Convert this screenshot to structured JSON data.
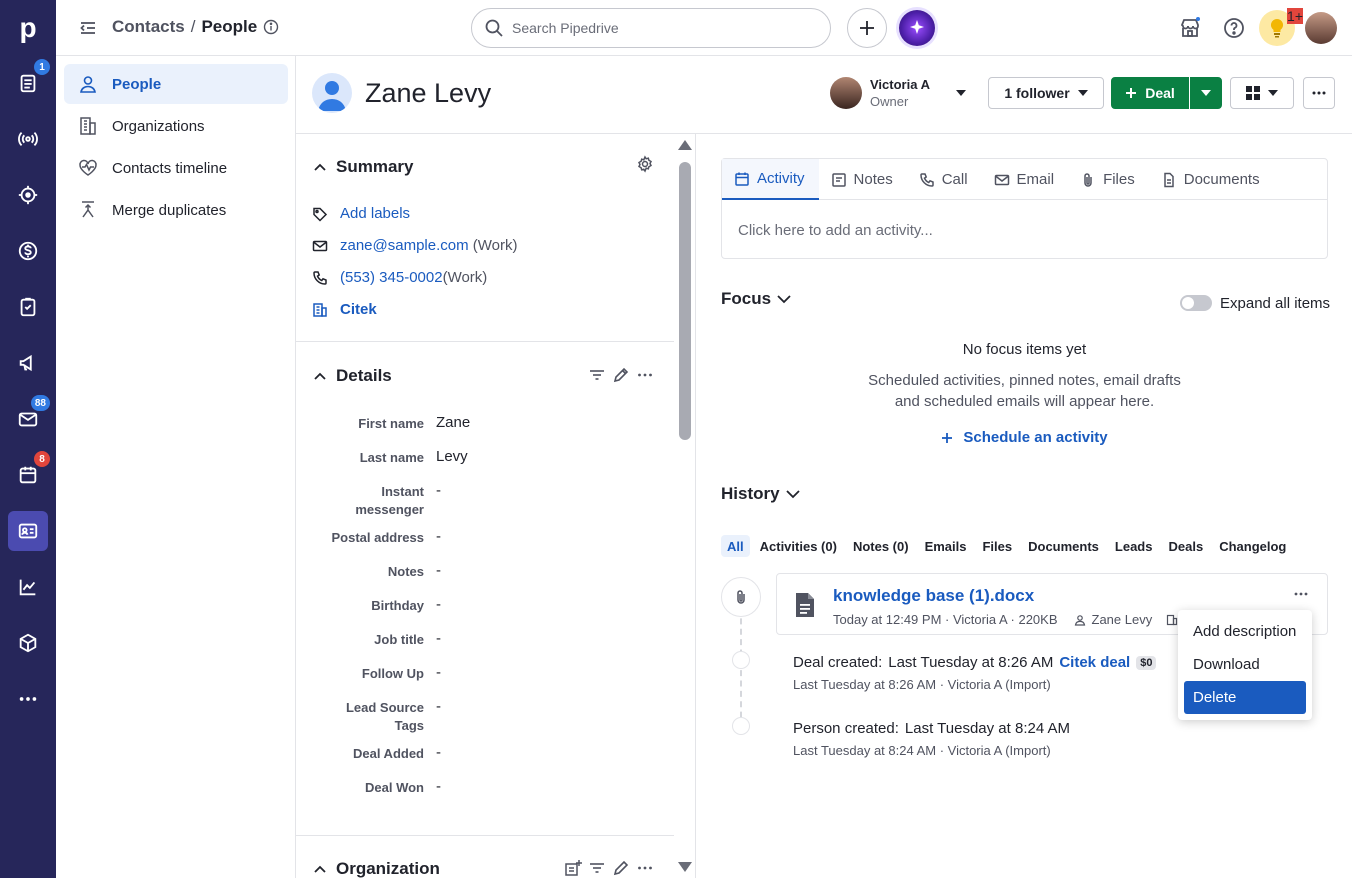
{
  "rail": {
    "logo": "p",
    "badges": {
      "deals": "1",
      "mail": "88",
      "calendar": "8"
    }
  },
  "topbar": {
    "crumb_parent": "Contacts",
    "crumb_sep": "/",
    "crumb_current": "People",
    "search_placeholder": "Search Pipedrive",
    "notif_badge": "1+"
  },
  "sidenav": {
    "items": [
      {
        "label": "People"
      },
      {
        "label": "Organizations"
      },
      {
        "label": "Contacts timeline"
      },
      {
        "label": "Merge duplicates"
      }
    ]
  },
  "person": {
    "name": "Zane Levy",
    "owner_name": "Victoria A",
    "owner_role": "Owner",
    "follower_label": "1 follower",
    "deal_label": "Deal"
  },
  "summary": {
    "title": "Summary",
    "add_labels": "Add labels",
    "email": "zane@sample.com",
    "email_type": "(Work)",
    "phone": "(553) 345-0002",
    "phone_type": "(Work)",
    "org": "Citek"
  },
  "details": {
    "title": "Details",
    "fields": [
      {
        "label": "First name",
        "value": "Zane"
      },
      {
        "label": "Last name",
        "value": "Levy"
      },
      {
        "label": "Instant messenger",
        "value": "-"
      },
      {
        "label": "Postal address",
        "value": "-"
      },
      {
        "label": "Notes",
        "value": "-"
      },
      {
        "label": "Birthday",
        "value": "-"
      },
      {
        "label": "Job title",
        "value": "-"
      },
      {
        "label": "Follow Up",
        "value": "-"
      },
      {
        "label": "Lead Source Tags",
        "value": "-"
      },
      {
        "label": "Deal Added",
        "value": "-"
      },
      {
        "label": "Deal Won",
        "value": "-"
      }
    ]
  },
  "organization": {
    "title": "Organization"
  },
  "composer": {
    "tabs": [
      {
        "label": "Activity"
      },
      {
        "label": "Notes"
      },
      {
        "label": "Call"
      },
      {
        "label": "Email"
      },
      {
        "label": "Files"
      },
      {
        "label": "Documents"
      }
    ],
    "placeholder": "Click here to add an activity..."
  },
  "focus": {
    "title": "Focus",
    "expand_label": "Expand all items",
    "empty_title": "No focus items yet",
    "empty_line1": "Scheduled activities, pinned notes, email drafts",
    "empty_line2": "and scheduled emails will appear here.",
    "schedule_label": "Schedule an activity"
  },
  "history": {
    "title": "History",
    "tabs": [
      "All",
      "Activities (0)",
      "Notes (0)",
      "Emails",
      "Files",
      "Documents",
      "Leads",
      "Deals",
      "Changelog"
    ],
    "file": {
      "name": "knowledge base (1).docx",
      "meta": "Today at 12:49 PM · Victoria A · 220KB",
      "person": "Zane Levy"
    },
    "events": [
      {
        "title": "Deal created",
        "when": "Last Tuesday at 8:26 AM",
        "link": "Citek deal",
        "pill": "$0",
        "sub": "Last Tuesday at 8:26 AM · Victoria A (Import)"
      },
      {
        "title": "Person created",
        "when": "Last Tuesday at 8:24 AM",
        "sub": "Last Tuesday at 8:24 AM · Victoria A (Import)"
      }
    ]
  },
  "context_menu": {
    "items": [
      "Add description",
      "Download",
      "Delete"
    ],
    "selected": "Delete"
  },
  "colors": {
    "rail": "#26265a",
    "accent": "#1a5bbf",
    "green": "#0a8043"
  }
}
